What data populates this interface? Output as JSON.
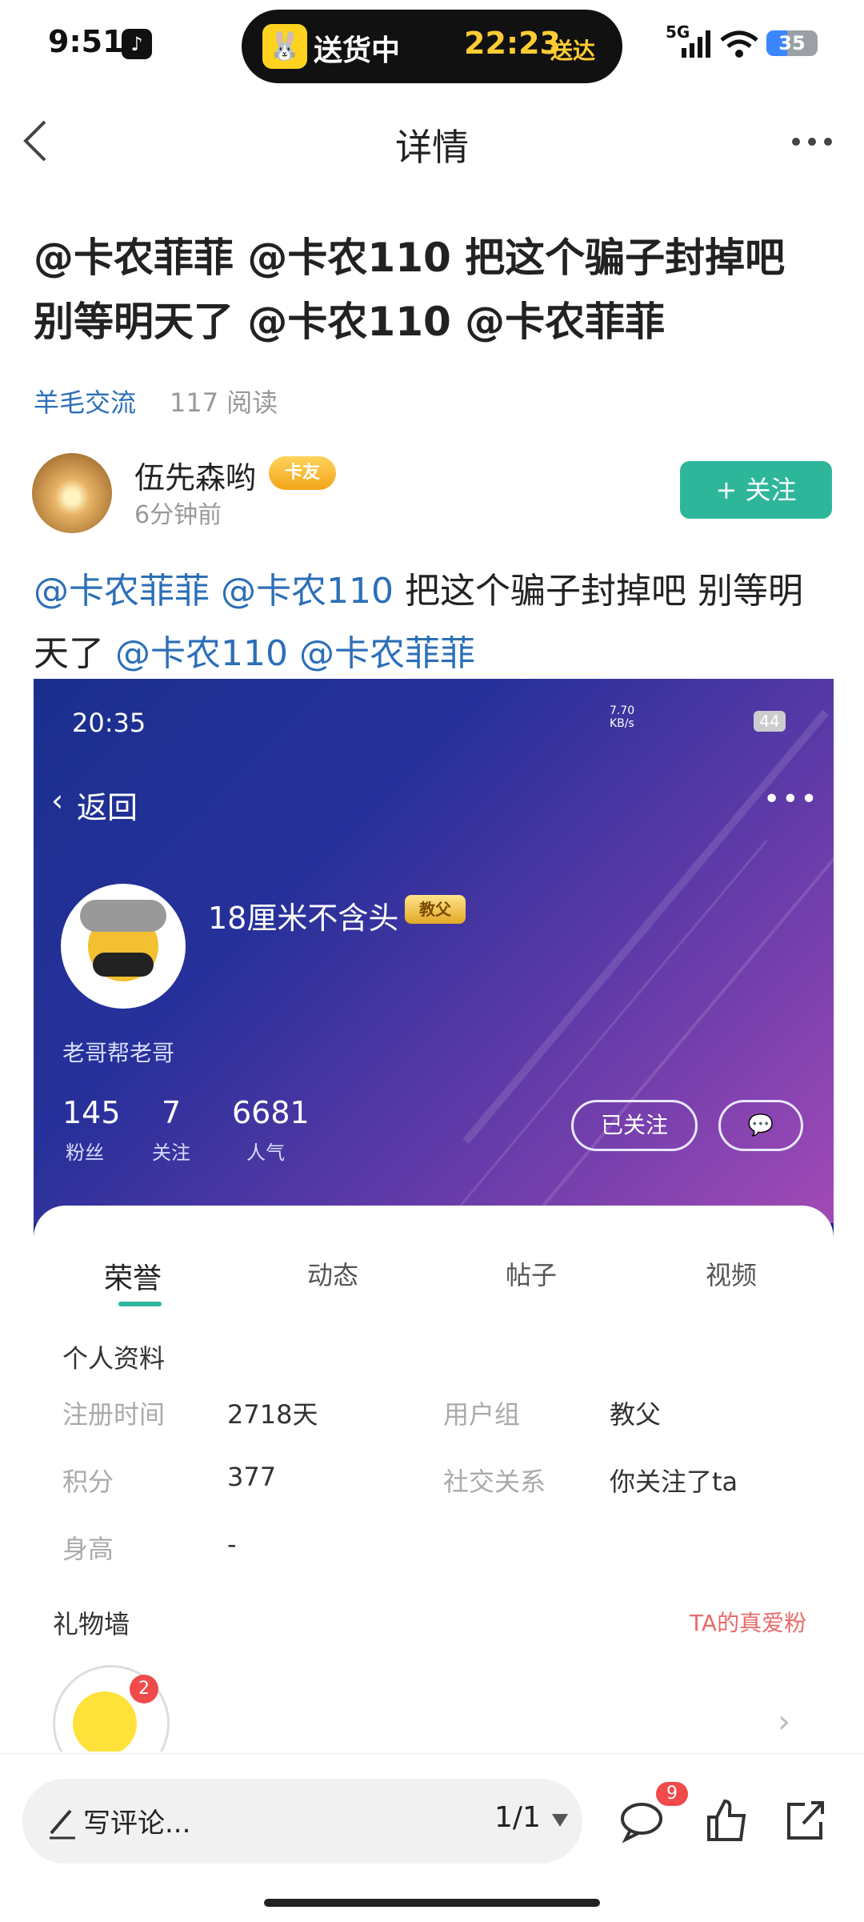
{
  "status_bar": {
    "time": "9:51",
    "app_icon": "tiktok-icon",
    "delivery_status": "送货中",
    "delivery_eta": "22:23",
    "delivery_eta_suffix": "送达",
    "network": "5G",
    "battery": "35"
  },
  "nav": {
    "title": "详情"
  },
  "post": {
    "title": "@卡农菲菲 @卡农110 把这个骗子封掉吧 别等明天了 @卡农110 @卡农菲菲",
    "board": "羊毛交流",
    "read_count": "117 阅读",
    "author": "伍先森哟",
    "author_badge": "卡友",
    "time": "6分钟前",
    "follow_label": "+ 关注",
    "body": {
      "mention1": "@卡农菲菲",
      "mention2": "@卡农110",
      "text1": "把这个骗子封掉吧 别等明",
      "text2": "天了",
      "mention3": "@卡农110",
      "mention4": "@卡农菲菲"
    }
  },
  "embedded_screenshot": {
    "time": "20:35",
    "net_speed": "7.70 KB/s",
    "battery": "44",
    "back_label": "返回",
    "username": "18厘米不含头",
    "user_badge": "教父",
    "group": "老哥帮老哥",
    "stats": [
      {
        "value": "145",
        "label": "粉丝"
      },
      {
        "value": "7",
        "label": "关注"
      },
      {
        "value": "6681",
        "label": "人气"
      }
    ],
    "followed_label": "已关注",
    "tabs": [
      "荣誉",
      "动态",
      "帖子",
      "视频"
    ],
    "active_tab": "荣誉",
    "profile_heading": "个人资料",
    "fields": {
      "reg_label": "注册时间",
      "reg_value": "2718天",
      "group_label": "用户组",
      "group_value": "教父",
      "points_label": "积分",
      "points_value": "377",
      "social_label": "社交关系",
      "social_value": "你关注了ta",
      "height_label": "身高",
      "height_value": "-"
    },
    "gift_wall": "礼物墙",
    "true_fans": "TA的真爱粉",
    "gift_count": "2"
  },
  "bottom_bar": {
    "comment_placeholder": "写评论...",
    "page_indicator": "1/1",
    "comment_count": "9"
  },
  "colors": {
    "accent": "#2eb69b",
    "mention": "#2c6fb7",
    "badge_red": "#f04a4a"
  }
}
